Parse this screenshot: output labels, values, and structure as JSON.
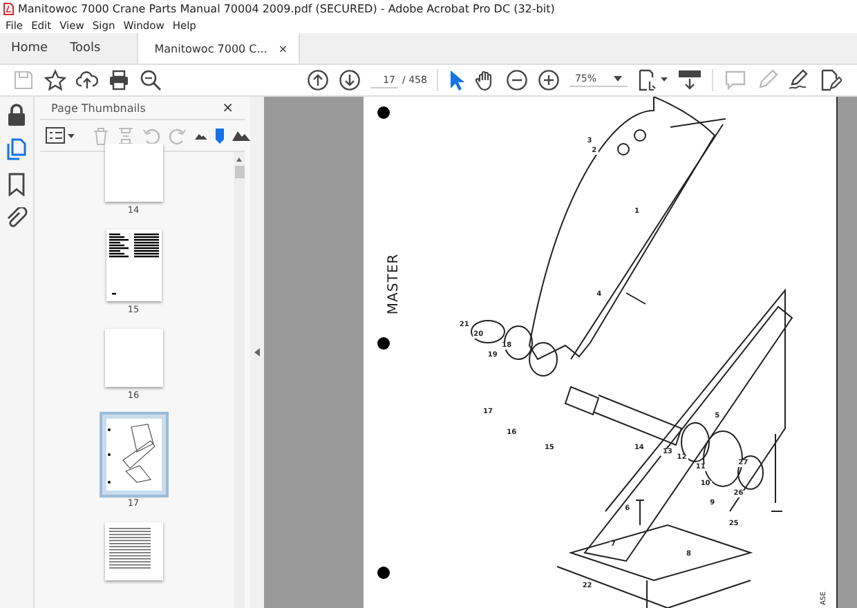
{
  "window": {
    "title": "Manitowoc 7000 Crane Parts Manual 70004 2009.pdf (SECURED) - Adobe Acrobat Pro DC (32-bit)"
  },
  "menu": [
    "File",
    "Edit",
    "View",
    "Sign",
    "Window",
    "Help"
  ],
  "tabs": [
    {
      "label": "Home",
      "selected": false,
      "kind": "nav"
    },
    {
      "label": "Tools",
      "selected": false,
      "kind": "nav"
    },
    {
      "label": "Manitowoc 7000 C...",
      "selected": true,
      "kind": "doc",
      "close": "×"
    }
  ],
  "toolbar": {
    "page": "17",
    "page_count": "/ 458",
    "zoom": "75%"
  },
  "rail": [
    {
      "kind": "lock",
      "selected": false
    },
    {
      "kind": "pages",
      "selected": true
    },
    {
      "kind": "bookmark",
      "selected": false
    },
    {
      "kind": "clip",
      "selected": false
    }
  ],
  "panel": {
    "title": "Page Thumbnails",
    "close": "×",
    "thumbnails": [
      {
        "label": "14",
        "kind": "blank",
        "selected": false
      },
      {
        "label": "15",
        "kind": "table",
        "selected": false
      },
      {
        "label": "16",
        "kind": "blank",
        "selected": false
      },
      {
        "label": "17",
        "kind": "drawing",
        "selected": true
      },
      {
        "kind": "list",
        "selected": false
      }
    ]
  },
  "page": {
    "side_label": "MASTER",
    "edge_text": "ASE",
    "callouts": [
      "3",
      "2",
      "1",
      "4",
      "21",
      "20",
      "19",
      "18",
      "17",
      "16",
      "15",
      "14",
      "13",
      "12",
      "11",
      "10",
      "9",
      "5",
      "27",
      "26",
      "25",
      "6",
      "7",
      "8",
      "22"
    ]
  }
}
